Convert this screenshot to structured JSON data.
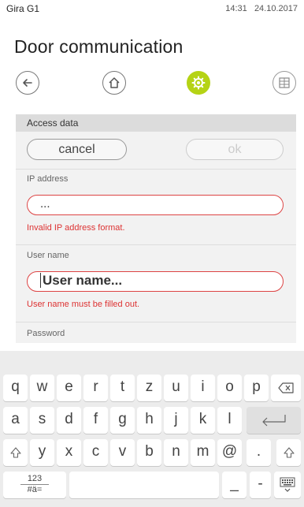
{
  "status": {
    "device": "Gira G1",
    "time": "14:31",
    "date": "24.10.2017"
  },
  "page": {
    "title": "Door communication"
  },
  "nav": {
    "icons": [
      "back-arrow-icon",
      "home-icon",
      "gear-icon",
      "grid-icon"
    ],
    "accent": "#b5d315"
  },
  "section": {
    "header": "Access data"
  },
  "actions": {
    "cancel": "cancel",
    "ok": "ok"
  },
  "fields": {
    "ip": {
      "label": "IP address",
      "value": "...",
      "error": "Invalid IP address format."
    },
    "username": {
      "label": "User name",
      "placeholder": "User name...",
      "error": "User name must be filled out."
    },
    "password": {
      "label": "Password"
    }
  },
  "keyboard": {
    "row1": [
      "q",
      "w",
      "e",
      "r",
      "t",
      "z",
      "u",
      "i",
      "o",
      "p"
    ],
    "row2": [
      "a",
      "s",
      "d",
      "f",
      "g",
      "h",
      "j",
      "k",
      "l"
    ],
    "row3": [
      "y",
      "x",
      "c",
      "v",
      "b",
      "n",
      "m",
      "@",
      "."
    ],
    "mode_top": "123",
    "mode_bottom": "#ä=",
    "underscore": "_",
    "dash": "-"
  },
  "colors": {
    "error": "#dd3333",
    "accent": "#b5d315"
  }
}
